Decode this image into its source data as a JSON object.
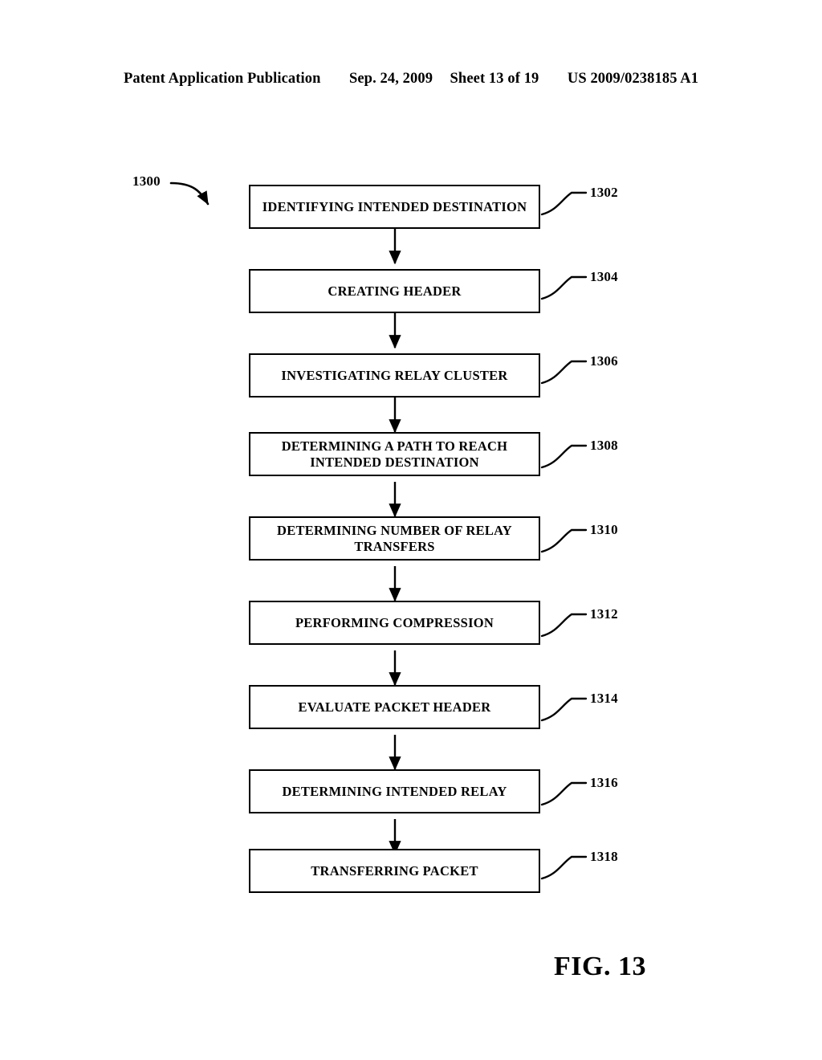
{
  "header": {
    "publication": "Patent Application Publication",
    "date": "Sep. 24, 2009",
    "sheet": "Sheet 13 of 19",
    "doc_number": "US 2009/0238185 A1"
  },
  "figure": {
    "caption": "FIG. 13",
    "diagram_label": "1300",
    "steps": [
      {
        "ref": "1302",
        "text": "IDENTIFYING INTENDED DESTINATION"
      },
      {
        "ref": "1304",
        "text": "CREATING HEADER"
      },
      {
        "ref": "1306",
        "text": "INVESTIGATING RELAY CLUSTER"
      },
      {
        "ref": "1308",
        "text": "DETERMINING A PATH TO REACH\nINTENDED DESTINATION"
      },
      {
        "ref": "1310",
        "text": "DETERMINING NUMBER OF RELAY\nTRANSFERS"
      },
      {
        "ref": "1312",
        "text": "PERFORMING COMPRESSION"
      },
      {
        "ref": "1314",
        "text": "EVALUATE PACKET HEADER"
      },
      {
        "ref": "1316",
        "text": "DETERMINING INTENDED RELAY"
      },
      {
        "ref": "1318",
        "text": "TRANSFERRING PACKET"
      }
    ]
  },
  "colors": {
    "ink": "#000000",
    "paper": "#ffffff"
  }
}
